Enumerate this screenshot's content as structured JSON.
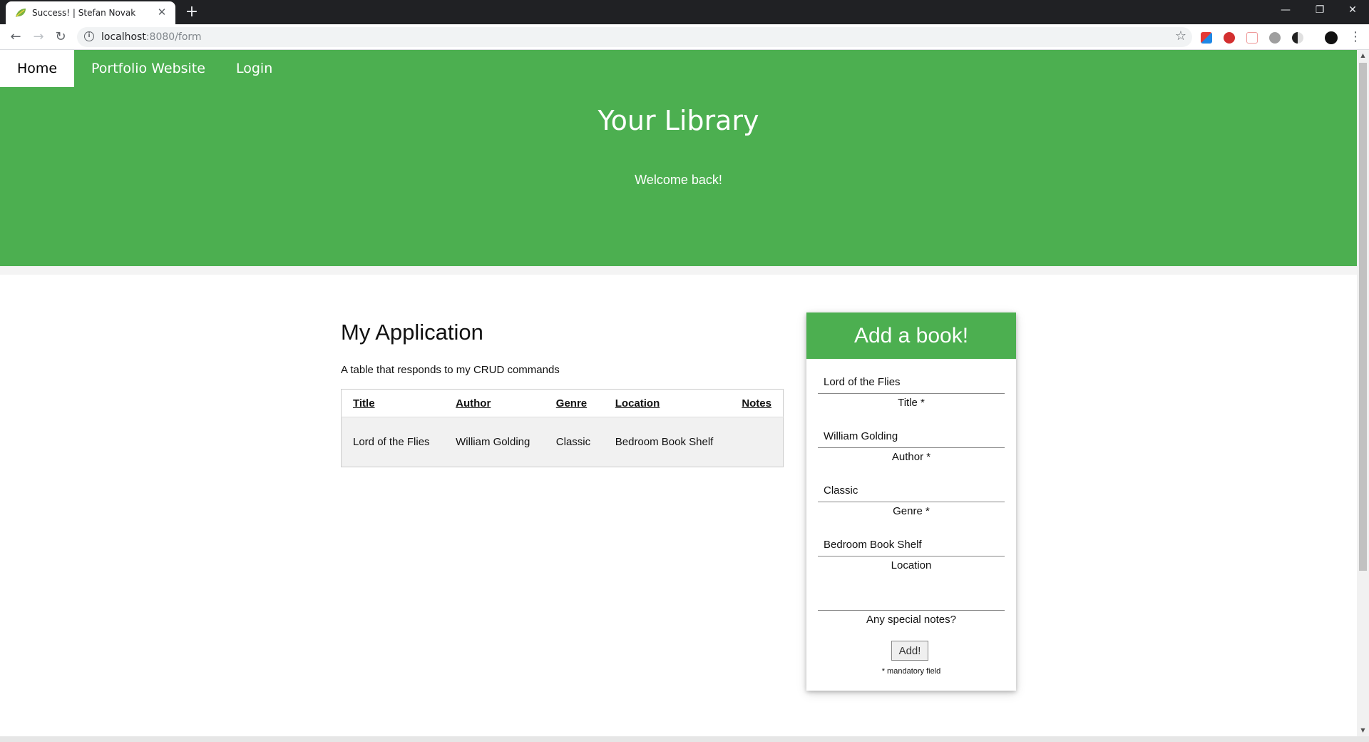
{
  "browser": {
    "tab_title": "Success! | Stefan Novak",
    "tab_close": "✕",
    "new_tab": "+",
    "url_host": "localhost",
    "url_path": ":8080/form",
    "window_controls": {
      "minimize": "—",
      "restore": "❐",
      "close": "✕"
    }
  },
  "navbar": {
    "items": [
      {
        "label": "Home",
        "active": true
      },
      {
        "label": "Portfolio Website",
        "active": false
      },
      {
        "label": "Login",
        "active": false
      }
    ]
  },
  "hero": {
    "title": "Your Library",
    "subtitle": "Welcome back!"
  },
  "main": {
    "title": "My Application",
    "description": "A table that responds to my CRUD commands",
    "table": {
      "headers": [
        "Title",
        "Author",
        "Genre",
        "Location",
        "Notes"
      ],
      "rows": [
        [
          "Lord of the Flies",
          "William Golding",
          "Classic",
          "Bedroom Book Shelf",
          ""
        ]
      ]
    }
  },
  "form": {
    "title": "Add a book!",
    "fields": [
      {
        "value": "Lord of the Flies",
        "label": "Title *"
      },
      {
        "value": "William Golding",
        "label": "Author *"
      },
      {
        "value": "Classic",
        "label": "Genre *"
      },
      {
        "value": "Bedroom Book Shelf",
        "label": "Location"
      },
      {
        "value": "",
        "label": "Any special notes?"
      }
    ],
    "submit_label": "Add!",
    "footnote": "* mandatory field"
  },
  "colors": {
    "brand_green": "#4caf50",
    "chrome_dark": "#202124"
  }
}
